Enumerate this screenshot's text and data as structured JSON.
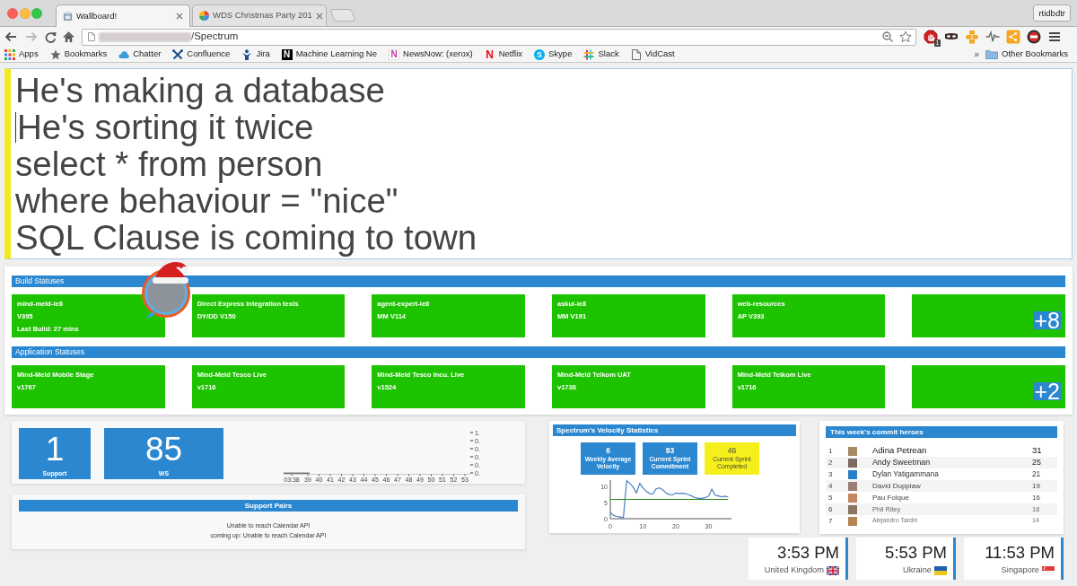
{
  "browser": {
    "tabs": [
      {
        "title": "Wallboard!",
        "selected": true
      },
      {
        "title": "WDS Christmas Party 201",
        "selected": false
      }
    ],
    "profile": "rtidbdtr",
    "address": "/Spectrum",
    "extension_badge": "1",
    "bookmarks": [
      {
        "label": "Apps"
      },
      {
        "label": "Bookmarks"
      },
      {
        "label": "Chatter"
      },
      {
        "label": "Confluence"
      },
      {
        "label": "Jira"
      },
      {
        "label": "Machine Learning Ne",
        "icon_text": "N"
      },
      {
        "label": "NewsNow: (xerox)",
        "icon_text": "N"
      },
      {
        "label": "Netflix",
        "icon_text": "N"
      },
      {
        "label": "Skype",
        "icon_text": "S"
      },
      {
        "label": "Slack"
      },
      {
        "label": "VidCast"
      }
    ],
    "bookmarks_overflow": "»",
    "other_bookmarks": "Other Bookmarks"
  },
  "poem": {
    "lines": [
      {
        "text": "He's making a database",
        "caret": false
      },
      {
        "text": "He's sorting it twice",
        "caret": true
      },
      {
        "text": "select * from person",
        "caret": false
      },
      {
        "text": "where behaviour = \"nice\"",
        "caret": false
      },
      {
        "text": "SQL Clause is coming to town",
        "caret": false
      }
    ]
  },
  "build_statuses": {
    "title": "Build Statuses",
    "cards": [
      {
        "name": "mind-meld-ie8",
        "version": "V395",
        "last_build": "Last Build: 27 mins",
        "passing": true
      },
      {
        "name": "Direct Express integration tests",
        "version": "DY/DD V150",
        "passing": true
      },
      {
        "name": "agent-expert-ie8",
        "version": "MM V114",
        "passing": true
      },
      {
        "name": "askui-ie8",
        "version": "MM V191",
        "passing": true
      },
      {
        "name": "web-resources",
        "version": "AP V393",
        "passing": true
      }
    ],
    "more": {
      "label": "+8",
      "passing": true
    }
  },
  "application_statuses": {
    "title": "Application Statuses",
    "cards": [
      {
        "name": "Mind-Meld Mobile Stage",
        "version": "v1767",
        "passing": true
      },
      {
        "name": "Mind-Meld Tesco Live",
        "version": "v1716",
        "passing": true
      },
      {
        "name": "Mind-Meld Tesco Incu. Live",
        "version": "v1524",
        "passing": true
      },
      {
        "name": "Mind-Meld Telkom UAT",
        "version": "v1736",
        "passing": true
      },
      {
        "name": "Mind-Meld Telkom Live",
        "version": "v1716",
        "passing": true
      }
    ],
    "more": {
      "label": "+2",
      "passing": true
    }
  },
  "counters": [
    {
      "value": "1",
      "label": "Support"
    },
    {
      "value": "85",
      "label": "WS"
    }
  ],
  "timeline": {
    "y_tick_labels": [
      "1.",
      "0.",
      "0.",
      "0.",
      "0.",
      "0."
    ],
    "x_tick_labels": [
      "03:38",
      "39",
      "40",
      "41",
      "42",
      "43",
      "44",
      "45",
      "46",
      "47",
      "48",
      "49",
      "50",
      "51",
      "52",
      "53"
    ]
  },
  "support_pairs": {
    "title": "Support Pairs",
    "messages": [
      "Unable to reach Calendar API",
      "coming up: Unable to reach Calendar API"
    ]
  },
  "velocity": {
    "title": "Spectrum's Velocity Statistics",
    "tiles": [
      {
        "value": "6",
        "label": "Weekly Average Velocity",
        "color": "#2a87d0"
      },
      {
        "value": "83",
        "label": "Current Sprint Commitment",
        "color": "#2a87d0"
      },
      {
        "value": "46",
        "label": "Current Sprint Completed",
        "color": "#f5f01c"
      }
    ],
    "chart_data": {
      "type": "line",
      "x": [
        0,
        1,
        2,
        3,
        4,
        5,
        6,
        7,
        8,
        9,
        10,
        11,
        12,
        13,
        14,
        15,
        16,
        17,
        18,
        19,
        20,
        21,
        22,
        23,
        24,
        25,
        26,
        27,
        28,
        29,
        30,
        31,
        32,
        33,
        34,
        35,
        36
      ],
      "series": [
        {
          "color": "#4a7fc0",
          "values": [
            2,
            1,
            0.7,
            0.5,
            0.3,
            11.8,
            11,
            9.8,
            8,
            11,
            9.5,
            8.5,
            7.8,
            7.7,
            9.3,
            9.6,
            9,
            8,
            7.5,
            7.4,
            8,
            7.8,
            7.9,
            7.8,
            7.4,
            7,
            6.5,
            6.3,
            6.3,
            6.5,
            7,
            9.2,
            7.3,
            7.1,
            6.8,
            7,
            6.7
          ]
        },
        {
          "color": "#2e8b22",
          "values": [
            6,
            6,
            6,
            6,
            6,
            6,
            6,
            6,
            6,
            6,
            6,
            6,
            6,
            6,
            6,
            6,
            6,
            6,
            6,
            6,
            6,
            6,
            6,
            6,
            6,
            6,
            6,
            6,
            6,
            6,
            6,
            6,
            6,
            6,
            6,
            6,
            6
          ]
        }
      ],
      "xlim": [
        0,
        37
      ],
      "ylim": [
        0,
        12
      ],
      "xticks": [
        0,
        10,
        20,
        30
      ],
      "yticks": [
        0,
        5,
        10
      ]
    }
  },
  "commit_heroes": {
    "title": "This week's commit heroes",
    "rows": [
      {
        "rank": "1",
        "name": "Adina Petrean",
        "commits": "31"
      },
      {
        "rank": "2",
        "name": "Andy Sweetman",
        "commits": "25"
      },
      {
        "rank": "3",
        "name": "Dylan Yatigammana",
        "commits": "21"
      },
      {
        "rank": "4",
        "name": "David Dupplaw",
        "commits": "19"
      },
      {
        "rank": "5",
        "name": "Pau Folque",
        "commits": "16"
      },
      {
        "rank": "6",
        "name": "Phil Riley",
        "commits": "16"
      },
      {
        "rank": "7",
        "name": "Alejandro Tardin",
        "commits": "14"
      }
    ]
  },
  "clocks": [
    {
      "time": "3:53 PM",
      "location": "United Kingdom",
      "kind": "uk"
    },
    {
      "time": "5:53 PM",
      "location": "Ukraine",
      "kind": "ukraine"
    },
    {
      "time": "11:53 PM",
      "location": "Singapore",
      "kind": "singapore"
    }
  ]
}
